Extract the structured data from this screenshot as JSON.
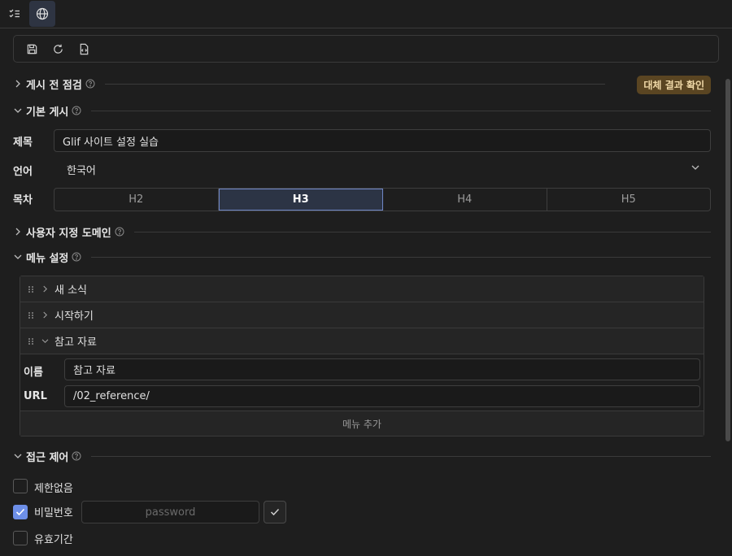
{
  "topbar": {
    "tabs": [
      {
        "icon": "checklist-icon"
      },
      {
        "icon": "globe-icon",
        "active": true
      }
    ]
  },
  "toolbar": {
    "buttons": [
      {
        "icon": "save-icon"
      },
      {
        "icon": "refresh-icon"
      },
      {
        "icon": "file-code-icon"
      }
    ]
  },
  "sections": {
    "precheck": {
      "title": "게시 전 점검",
      "collapsed": true,
      "badge": "대체 결과 확인"
    },
    "basic": {
      "title": "기본 게시",
      "collapsed": false
    },
    "domain": {
      "title": "사용자 지정 도메인",
      "collapsed": true
    },
    "menu": {
      "title": "메뉴 설정",
      "collapsed": false
    },
    "access": {
      "title": "접근 제어",
      "collapsed": false
    }
  },
  "basic": {
    "title_label": "제목",
    "title_value": "Glif 사이트 설정 실습",
    "language_label": "언어",
    "language_value": "한국어",
    "toc_label": "목차",
    "toc_options": [
      "H2",
      "H3",
      "H4",
      "H5"
    ],
    "toc_selected": "H3"
  },
  "menu": {
    "items": [
      {
        "label": "새 소식",
        "expanded": false
      },
      {
        "label": "시작하기",
        "expanded": false
      },
      {
        "label": "참고 자료",
        "expanded": true
      }
    ],
    "name_label": "이름",
    "name_value": "참고 자료",
    "url_label": "URL",
    "url_value": "/02_reference/",
    "add_label": "메뉴 추가"
  },
  "access": {
    "options": [
      {
        "label": "제한없음",
        "checked": false
      },
      {
        "label": "비밀번호",
        "checked": true
      },
      {
        "label": "유효기간",
        "checked": false
      }
    ],
    "password_placeholder": "password"
  },
  "colors": {
    "background": "#1e1e1e",
    "accent": "#6d8fe8",
    "badge_bg": "#5a4522",
    "badge_text": "#f0d9a8",
    "selected_segment": "#2c3445"
  }
}
